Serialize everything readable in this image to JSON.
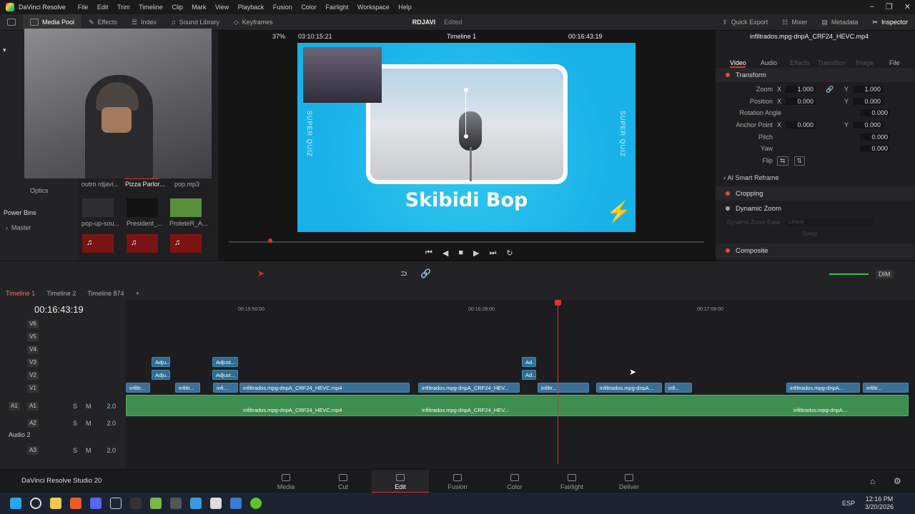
{
  "titlebar": {
    "app": "DaVinci Resolve",
    "menu": [
      "File",
      "Edit",
      "Trim",
      "Timeline",
      "Clip",
      "Mark",
      "View",
      "Playback",
      "Fusion",
      "Color",
      "Fairlight",
      "Workspace",
      "Help"
    ]
  },
  "toolbar": {
    "left": [
      "Media Pool",
      "Effects",
      "Index",
      "Sound Library",
      "Keyframes"
    ],
    "project": "RDJAVI",
    "status": "Edited",
    "right": [
      "Quick Export",
      "Mixer",
      "Metadata",
      "Inspector"
    ]
  },
  "viewer": {
    "zoom": "37%",
    "src_tc": "03:10:15:21",
    "timeline_name": "Timeline 1",
    "tc": "00:16:43:19",
    "overlay_title": "Skibidi Bop",
    "side_text": "SUPER QUIZ"
  },
  "inspector": {
    "filename": "infiltrados.mpg-dnpA_CRF24_HEVC.mp4",
    "tabs": [
      "Video",
      "Audio",
      "Effects",
      "Transition",
      "Image",
      "File"
    ],
    "transform": "Transform",
    "zoom_label": "Zoom",
    "zoom_x": "1.000",
    "zoom_y": "1.000",
    "position_label": "Position",
    "pos_x": "0.000",
    "pos_y": "0.000",
    "rotation_label": "Rotation Angle",
    "rotation": "0.000",
    "anchor_label": "Anchor Point",
    "anchor_x": "0.000",
    "anchor_y": "0.000",
    "pitch_label": "Pitch",
    "pitch": "0.000",
    "yaw_label": "Yaw",
    "yaw": "0.000",
    "flip_label": "Flip",
    "smart_reframe": "AI Smart Reframe",
    "cropping": "Cropping",
    "dynamic_zoom": "Dynamic Zoom",
    "dz_ease": "Dynamic Zoom Ease",
    "dz_linear": "Linear",
    "swap": "Swap",
    "composite": "Composite",
    "x": "X",
    "y": "Y"
  },
  "pool": {
    "clips": [
      "outro rdjavi...",
      "Pizza Parlor...",
      "pop.mp3",
      "pop-up-sou...",
      "President_...",
      "ProleteR_A..."
    ],
    "optics": "Optics",
    "power_bins": "Power Bins",
    "master": "Master"
  },
  "timeline": {
    "tabs": [
      "Timeline 1",
      "Timeline 2",
      "Timeline 874"
    ],
    "tc": "00:16:43:19",
    "ruler": [
      "00:15:50:00",
      "00:16:28:00",
      "00:17:06:00"
    ],
    "tracks": [
      "V6",
      "V5",
      "V4",
      "V3",
      "V2",
      "V1",
      "A1",
      "A2",
      "A3"
    ],
    "a1": "A1",
    "audio2": "Audio 2",
    "vol": "2.0",
    "s": "S",
    "m": "M",
    "clip_main": "infiltrados.mpg-dnpA_CRF24_HEVC.mp4",
    "clip_short": "infiltrados.mpg-dnpA_CRF24_HEV...",
    "clip_mid": "infiltrados.mpg-dnpA...",
    "clip_small": "infiltr...",
    "clip_tiny": "infi...",
    "adj": "Adjust...",
    "adj2": "Adju...",
    "ad": "Ad..."
  },
  "pages": [
    "Media",
    "Cut",
    "Edit",
    "Fusion",
    "Color",
    "Fairlight",
    "Deliver"
  ],
  "studio": "DaVinci Resolve Studio 20",
  "audio": {
    "dim": "DIM"
  },
  "taskbar": {
    "lang": "ESP",
    "time": "12:16 PM",
    "date": "3/20/2026"
  }
}
